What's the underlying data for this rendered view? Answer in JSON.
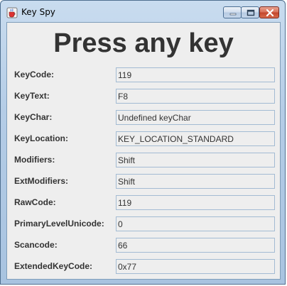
{
  "window": {
    "title": "Key Spy",
    "app_icon": "java-cup-icon",
    "controls": [
      "minimize-icon",
      "maximize-icon",
      "close-icon"
    ]
  },
  "main": {
    "heading": "Press any key",
    "rows": [
      {
        "label": "KeyCode:",
        "value": "119"
      },
      {
        "label": "KeyText:",
        "value": "F8"
      },
      {
        "label": "KeyChar:",
        "value": "Undefined keyChar"
      },
      {
        "label": "KeyLocation:",
        "value": "KEY_LOCATION_STANDARD"
      },
      {
        "label": "Modifiers:",
        "value": "Shift"
      },
      {
        "label": "ExtModifiers:",
        "value": "Shift"
      },
      {
        "label": "RawCode:",
        "value": "119"
      },
      {
        "label": "PrimaryLevelUnicode:",
        "value": "0"
      },
      {
        "label": "Scancode:",
        "value": "66"
      },
      {
        "label": "ExtendedKeyCode:",
        "value": "0x77"
      }
    ]
  },
  "colors": {
    "title_bar": "#b4cce6",
    "panel": "#eeeeee",
    "text": "#333333",
    "field_border": "#a3bbd3",
    "close_button": "#c2442a"
  }
}
